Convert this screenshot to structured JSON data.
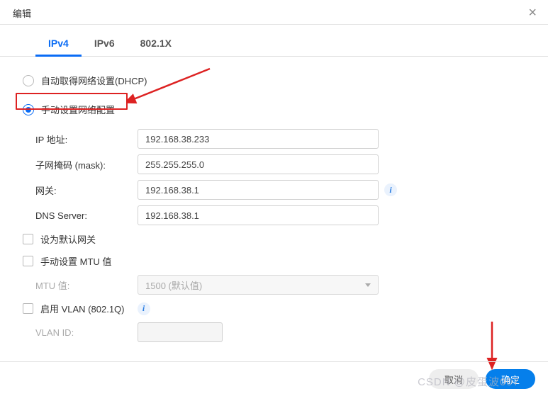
{
  "header": {
    "title": "编辑"
  },
  "tabs": [
    {
      "label": "IPv4",
      "active": true
    },
    {
      "label": "IPv6",
      "active": false
    },
    {
      "label": "802.1X",
      "active": false
    }
  ],
  "radios": {
    "dhcp": {
      "label": "自动取得网络设置(DHCP)",
      "checked": false
    },
    "manual": {
      "label": "手动设置网络配置",
      "checked": true
    }
  },
  "fields": {
    "ip": {
      "label": "IP 地址:",
      "value": "192.168.38.233"
    },
    "mask": {
      "label": "子网掩码 (mask):",
      "value": "255.255.255.0"
    },
    "gateway": {
      "label": "网关:",
      "value": "192.168.38.1"
    },
    "dns": {
      "label": "DNS Server:",
      "value": "192.168.38.1"
    },
    "mtu": {
      "label": "MTU 值:",
      "placeholder": "1500 (默认值)"
    },
    "vlanid": {
      "label": "VLAN ID:"
    }
  },
  "checkboxes": {
    "default_gateway": {
      "label": "设为默认网关",
      "checked": false
    },
    "manual_mtu": {
      "label": "手动设置 MTU 值",
      "checked": false
    },
    "enable_vlan": {
      "label": "启用 VLAN (802.1Q)",
      "checked": false
    }
  },
  "buttons": {
    "cancel": "取消",
    "confirm": "确定"
  },
  "watermark": "CSDN @皮蛋波007",
  "info_glyph": "i"
}
